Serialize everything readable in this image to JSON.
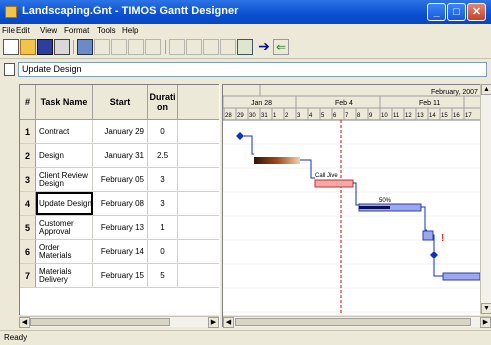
{
  "window": {
    "title": "Landscaping.Gnt - TIMOS Gantt Designer",
    "title_color": "#0a4fd0"
  },
  "menu": [
    "File",
    "Edit",
    "View",
    "Format",
    "Tools",
    "Help"
  ],
  "toolbar": {
    "buttons": [
      "new",
      "open",
      "save",
      "print",
      "cut",
      "indent",
      "outdent",
      "insert",
      "delete",
      "link",
      "unlink",
      "calendar",
      "forward",
      "back"
    ]
  },
  "editbar": {
    "value": "Update Design"
  },
  "grid": {
    "headers": {
      "num": "#",
      "name": "Task Name",
      "start": "Start",
      "duration": "Durati on"
    },
    "rows": [
      {
        "num": "1",
        "name": "Contract",
        "start": "January 29",
        "duration": "0"
      },
      {
        "num": "2",
        "name": "Design",
        "start": "January 31",
        "duration": "2.5"
      },
      {
        "num": "3",
        "name": "Client Review Design",
        "start": "February 05",
        "duration": "3"
      },
      {
        "num": "4",
        "name": "Update Design",
        "start": "February 08",
        "duration": "3"
      },
      {
        "num": "5",
        "name": "Customer Approval",
        "start": "February 13",
        "duration": "1"
      },
      {
        "num": "6",
        "name": "Order Materials",
        "start": "February 14",
        "duration": "0"
      },
      {
        "num": "7",
        "name": "Materials Delivery",
        "start": "February 15",
        "duration": "5"
      }
    ]
  },
  "chart": {
    "top_label": "February, 2007",
    "weeks": [
      "Jan 28",
      "Feb 4",
      "Feb 11"
    ],
    "days": [
      "28",
      "29",
      "30",
      "31",
      "1",
      "2",
      "3",
      "4",
      "5",
      "6",
      "7",
      "8",
      "9",
      "10",
      "11",
      "12",
      "13",
      "14",
      "15",
      "16",
      "17"
    ],
    "bar_labels": {
      "call_jive": "Call Jive",
      "percent": "50%"
    },
    "today_color": "#e03030",
    "bar_color": "#9aa8f0",
    "milestone_color": "#1030c0"
  },
  "status": {
    "text": "Ready"
  }
}
